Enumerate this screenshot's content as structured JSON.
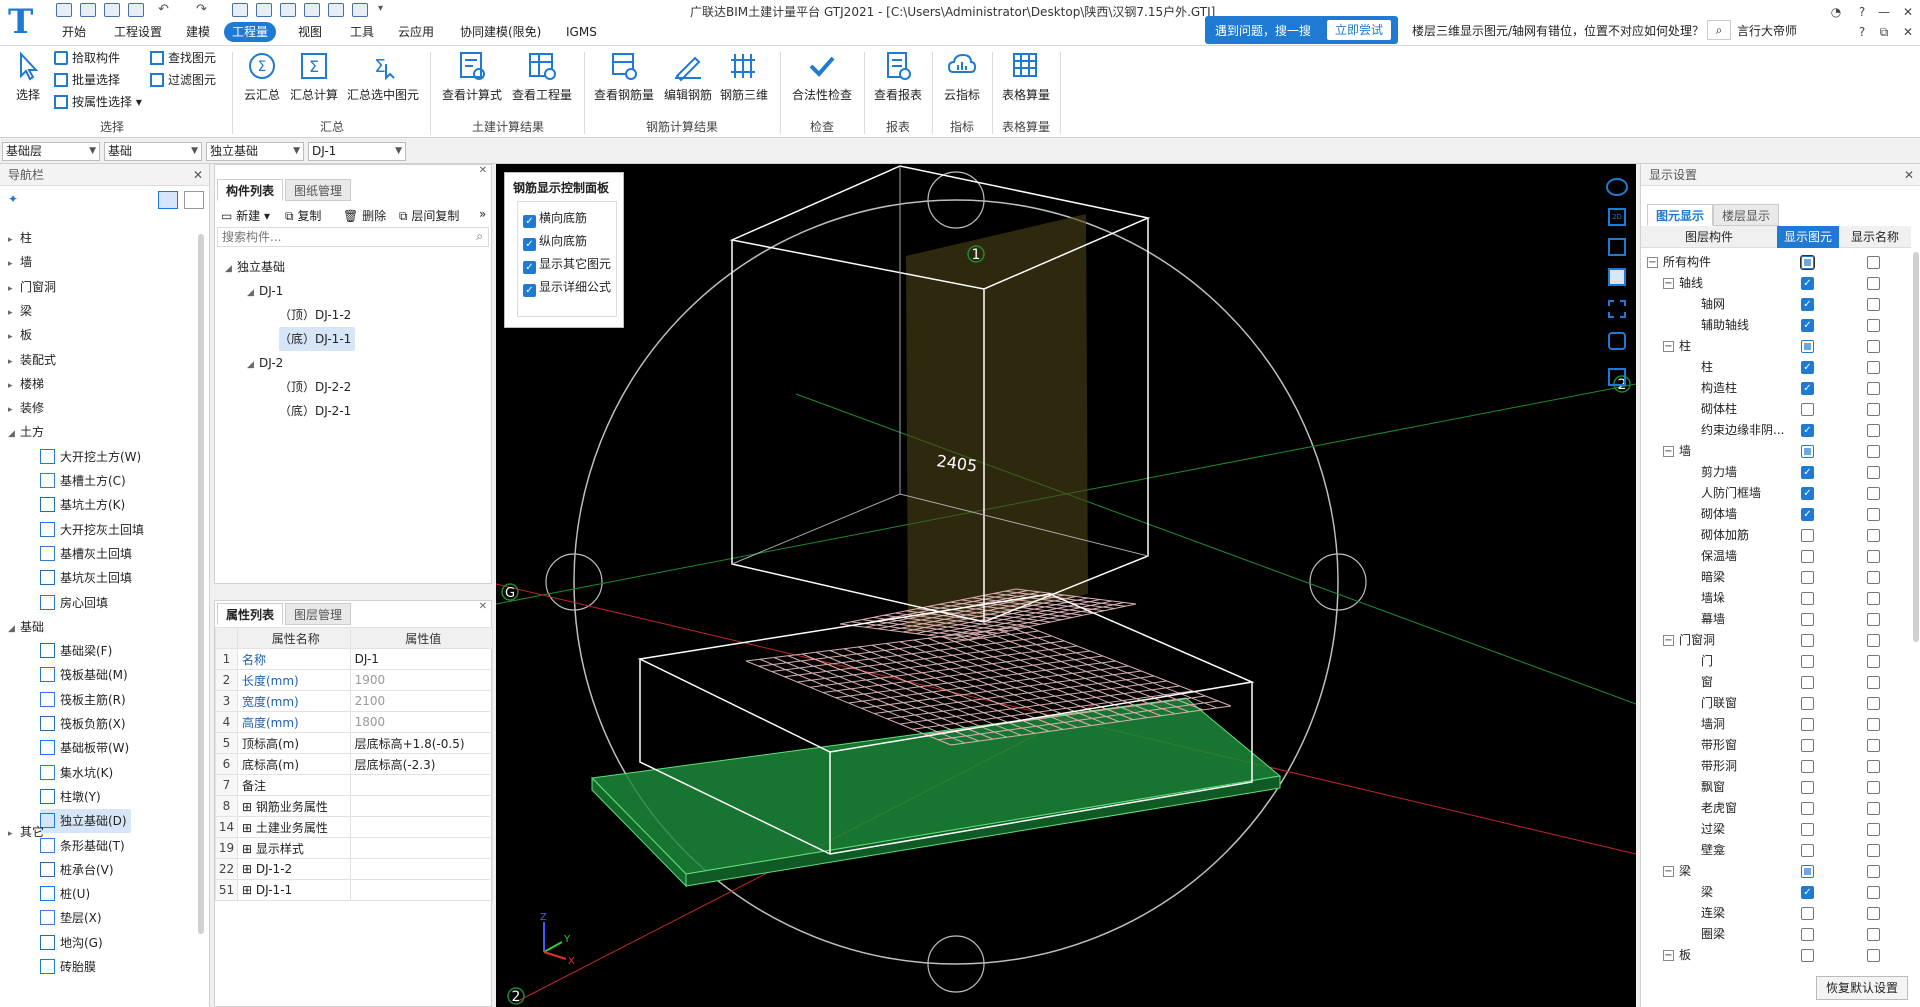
{
  "title": "广联达BIM土建计量平台 GTJ2021 - [C:\\Users\\Administrator\\Desktop\\陕西\\汉钢7.15户外.GTJ]",
  "menu": [
    "开始",
    "工程设置",
    "建模",
    "工程量",
    "视图",
    "工具",
    "云应用",
    "协同建模(限免)",
    "IGMS"
  ],
  "help": {
    "prompt": "遇到问题，搜一搜",
    "button": "立即尝试",
    "question": "楼层三维显示图元/轴网有错位，位置不对应如何处理？",
    "user": "言行大帝师"
  },
  "ribbon": {
    "select": {
      "big": "选择",
      "small": [
        "拾取构件",
        "批量选择",
        "按属性选择",
        "查找图元",
        "过滤图元"
      ],
      "group": "选择"
    },
    "summary": {
      "buttons": [
        "云汇总",
        "汇总计算",
        "汇总选中图元"
      ],
      "group": "汇总"
    },
    "civil": {
      "buttons": [
        "查看计算式",
        "查看工程量"
      ],
      "group": "土建计算结果"
    },
    "rebar": {
      "buttons": [
        "查看钢筋量",
        "编辑钢筋",
        "钢筋三维"
      ],
      "group": "钢筋计算结果"
    },
    "check": {
      "buttons": [
        "合法性检查"
      ],
      "group": "检查"
    },
    "report": {
      "buttons": [
        "查看报表"
      ],
      "group": "报表"
    },
    "index": {
      "buttons": [
        "云指标"
      ],
      "group": "指标"
    },
    "table": {
      "buttons": [
        "表格算量"
      ],
      "group": "表格算量"
    }
  },
  "selectors": [
    "基础层",
    "基础",
    "独立基础",
    "DJ-1"
  ],
  "nav": {
    "header": "导航栏",
    "items": [
      "柱",
      "墙",
      "门窗洞",
      "梁",
      "板",
      "装配式",
      "楼梯",
      "装修",
      "土方",
      "大开挖土方(W)",
      "基槽土方(C)",
      "基坑土方(K)",
      "大开挖灰土回填",
      "基槽灰土回填",
      "基坑灰土回填",
      "房心回填",
      "基础",
      "基础梁(F)",
      "筏板基础(M)",
      "筏板主筋(R)",
      "筏板负筋(X)",
      "基础板带(W)",
      "集水坑(K)",
      "柱墩(Y)",
      "独立基础(D)",
      "条形基础(T)",
      "桩承台(V)",
      "桩(U)",
      "垫层(X)",
      "地沟(G)",
      "砖胎膜",
      "其它"
    ]
  },
  "components": {
    "tabs": [
      "构件列表",
      "图纸管理"
    ],
    "toolbar": [
      "新建",
      "复制",
      "删除",
      "层间复制"
    ],
    "search_placeholder": "搜索构件...",
    "tree": [
      "独立基础",
      "DJ-1",
      "（顶）DJ-1-2",
      "（底）DJ-1-1",
      "DJ-2",
      "（顶）DJ-2-2",
      "（底）DJ-2-1"
    ]
  },
  "properties": {
    "tabs": [
      "属性列表",
      "图层管理"
    ],
    "headers": [
      "属性名称",
      "属性值"
    ],
    "rows": [
      [
        "1",
        "名称",
        "DJ-1"
      ],
      [
        "2",
        "长度(mm)",
        "1900"
      ],
      [
        "3",
        "宽度(mm)",
        "2100"
      ],
      [
        "4",
        "高度(mm)",
        "1800"
      ],
      [
        "5",
        "顶标高(m)",
        "层底标高+1.8(-0.5)"
      ],
      [
        "6",
        "底标高(m)",
        "层底标高(-2.3)"
      ],
      [
        "7",
        "备注",
        ""
      ],
      [
        "8",
        "钢筋业务属性",
        ""
      ],
      [
        "14",
        "土建业务属性",
        ""
      ],
      [
        "19",
        "显示样式",
        ""
      ],
      [
        "22",
        "DJ-1-2",
        ""
      ],
      [
        "51",
        "DJ-1-1",
        ""
      ]
    ]
  },
  "viewport": {
    "panel_title": "钢筋显示控制面板",
    "options": [
      "横向底筋",
      "纵向底筋",
      "显示其它图元",
      "显示详细公式"
    ],
    "dimension": "2405",
    "axis_labels": [
      "1",
      "2",
      "G",
      "2"
    ],
    "axes": [
      "Z",
      "Y",
      "X"
    ]
  },
  "display": {
    "header": "显示设置",
    "tabs": [
      "图元显示",
      "楼层显示"
    ],
    "columns": [
      "图层构件",
      "显示图元",
      "显示名称"
    ],
    "rows": [
      {
        "label": "所有构件",
        "level": 0,
        "show": "part",
        "name": false
      },
      {
        "label": "轴线",
        "level": 1,
        "show": "on",
        "name": false
      },
      {
        "label": "轴网",
        "level": 2,
        "show": "on",
        "name": false
      },
      {
        "label": "辅助轴线",
        "level": 2,
        "show": "on",
        "name": false
      },
      {
        "label": "柱",
        "level": 1,
        "show": "part",
        "name": false
      },
      {
        "label": "柱",
        "level": 2,
        "show": "on",
        "name": false
      },
      {
        "label": "构造柱",
        "level": 2,
        "show": "on",
        "name": false
      },
      {
        "label": "砌体柱",
        "level": 2,
        "show": "off",
        "name": false
      },
      {
        "label": "约束边缘非阴...",
        "level": 2,
        "show": "on",
        "name": false
      },
      {
        "label": "墙",
        "level": 1,
        "show": "part",
        "name": false
      },
      {
        "label": "剪力墙",
        "level": 2,
        "show": "on",
        "name": false
      },
      {
        "label": "人防门框墙",
        "level": 2,
        "show": "on",
        "name": false
      },
      {
        "label": "砌体墙",
        "level": 2,
        "show": "on",
        "name": false
      },
      {
        "label": "砌体加筋",
        "level": 2,
        "show": "off",
        "name": false
      },
      {
        "label": "保温墙",
        "level": 2,
        "show": "off",
        "name": false
      },
      {
        "label": "暗梁",
        "level": 2,
        "show": "off",
        "name": false
      },
      {
        "label": "墙垛",
        "level": 2,
        "show": "off",
        "name": false
      },
      {
        "label": "幕墙",
        "level": 2,
        "show": "off",
        "name": false
      },
      {
        "label": "门窗洞",
        "level": 1,
        "show": "off",
        "name": false
      },
      {
        "label": "门",
        "level": 2,
        "show": "off",
        "name": false
      },
      {
        "label": "窗",
        "level": 2,
        "show": "off",
        "name": false
      },
      {
        "label": "门联窗",
        "level": 2,
        "show": "off",
        "name": false
      },
      {
        "label": "墙洞",
        "level": 2,
        "show": "off",
        "name": false
      },
      {
        "label": "带形窗",
        "level": 2,
        "show": "off",
        "name": false
      },
      {
        "label": "带形洞",
        "level": 2,
        "show": "off",
        "name": false
      },
      {
        "label": "飘窗",
        "level": 2,
        "show": "off",
        "name": false
      },
      {
        "label": "老虎窗",
        "level": 2,
        "show": "off",
        "name": false
      },
      {
        "label": "过梁",
        "level": 2,
        "show": "off",
        "name": false
      },
      {
        "label": "壁龛",
        "level": 2,
        "show": "off",
        "name": false
      },
      {
        "label": "梁",
        "level": 1,
        "show": "part",
        "name": false
      },
      {
        "label": "梁",
        "level": 2,
        "show": "on",
        "name": false
      },
      {
        "label": "连梁",
        "level": 2,
        "show": "off",
        "name": false
      },
      {
        "label": "圈梁",
        "level": 2,
        "show": "off",
        "name": false
      },
      {
        "label": "板",
        "level": 1,
        "show": "off",
        "name": false
      }
    ],
    "restore": "恢复默认设置"
  }
}
